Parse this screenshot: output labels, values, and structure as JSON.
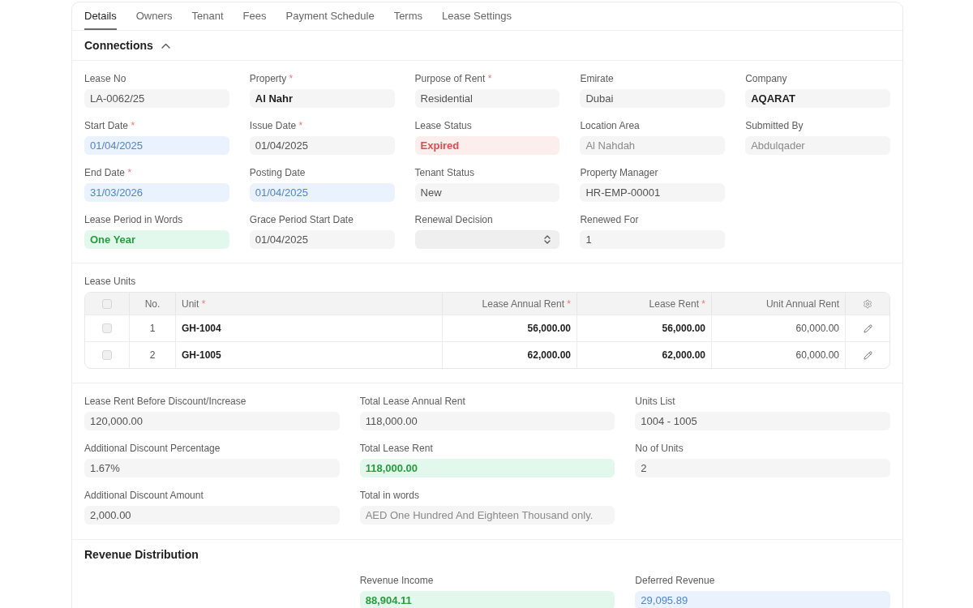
{
  "tabs": [
    {
      "label": "Details",
      "selected": true
    },
    {
      "label": "Owners",
      "selected": false
    },
    {
      "label": "Tenant",
      "selected": false
    },
    {
      "label": "Fees",
      "selected": false
    },
    {
      "label": "Payment Schedule",
      "selected": false
    },
    {
      "label": "Terms",
      "selected": false
    },
    {
      "label": "Lease Settings",
      "selected": false
    }
  ],
  "connections": {
    "title": "Connections",
    "expanded": true,
    "field_rows": [
      [
        {
          "label": "Lease No",
          "value": "LA-0062/25",
          "kind": "plain"
        },
        {
          "label": "Property",
          "required_mark": "*",
          "value": "Al Nahr",
          "kind": "strong"
        },
        {
          "label": "Purpose of Rent",
          "required_mark": "*",
          "value": "Residential",
          "kind": "plain"
        },
        {
          "label": "Emirate",
          "value": "Dubai",
          "kind": "plain"
        },
        {
          "label": "Company",
          "value": "AQARAT",
          "kind": "strong"
        }
      ],
      [
        {
          "label": "Start Date",
          "required_mark": "*",
          "value": "01/04/2025",
          "kind": "info"
        },
        {
          "label": "Issue Date",
          "required_mark": "*",
          "value": "01/04/2025",
          "kind": "plain"
        },
        {
          "label": "Lease Status",
          "value": "Expired",
          "kind": "danger"
        },
        {
          "label": "Location Area",
          "value": "Al Nahdah",
          "kind": "muted"
        },
        {
          "label": "Submitted By",
          "value": "Abdulqader",
          "kind": "muted"
        }
      ],
      [
        {
          "label": "End Date",
          "required_mark": "*",
          "value": "31/03/2026",
          "kind": "info"
        },
        {
          "label": "Posting Date",
          "value": "01/04/2025",
          "kind": "info"
        },
        {
          "label": "Tenant Status",
          "value": "New",
          "kind": "plain"
        },
        {
          "label": "Property Manager",
          "value": "HR-EMP-00001",
          "kind": "plain"
        }
      ],
      [
        {
          "label": "Lease Period in Words",
          "value": "One Year",
          "kind": "success"
        },
        {
          "label": "Grace Period Start Date",
          "value": "01/04/2025",
          "kind": "plain"
        },
        {
          "label": "Renewal Decision",
          "kind": "select"
        },
        {
          "label": "Renewed For",
          "value": "1",
          "kind": "plain"
        }
      ]
    ]
  },
  "lease_units": {
    "title": "Lease Units",
    "all_selected": false,
    "columns": [
      {
        "label": "No."
      },
      {
        "label": "Unit",
        "required_mark": "*"
      },
      {
        "label": "Lease Annual Rent",
        "required_mark": "*"
      },
      {
        "label": "Lease Rent",
        "required_mark": "*"
      },
      {
        "label": "Unit Annual Rent"
      }
    ],
    "rows": [
      {
        "selected": false,
        "cells": [
          "1",
          "GH-1004",
          "56,000.00",
          "56,000.00",
          "60,000.00"
        ]
      },
      {
        "selected": false,
        "cells": [
          "2",
          "GH-1005",
          "62,000.00",
          "62,000.00",
          "60,000.00"
        ]
      }
    ]
  },
  "totals": {
    "field_rows": [
      [
        {
          "label": "Lease Rent Before Discount/Increase",
          "value": "120,000.00",
          "kind": "plain"
        },
        {
          "label": "Total Lease Annual Rent",
          "value": "118,000.00",
          "kind": "plain"
        },
        {
          "label": "Units List",
          "value": "1004 - 1005",
          "kind": "plain"
        }
      ],
      [
        {
          "label": "Additional Discount Percentage",
          "value": "1.67%",
          "kind": "plain"
        },
        {
          "label": "Total Lease Rent",
          "value": "118,000.00",
          "kind": "success"
        },
        {
          "label": "No of Units",
          "value": "2",
          "kind": "plain"
        }
      ],
      [
        {
          "label": "Additional Discount Amount",
          "value": "2,000.00",
          "kind": "plain"
        },
        {
          "label": "Total in words",
          "value": "AED One Hundred And Eighteen Thousand only.",
          "kind": "muted"
        }
      ]
    ]
  },
  "revenue_distribution": {
    "title": "Revenue Distribution",
    "fields": [
      {
        "label": "Revenue Income",
        "value": "88,904.11",
        "kind": "success"
      },
      {
        "label": "Deferred Revenue",
        "value": "29,095.89",
        "kind": "info"
      }
    ]
  }
}
